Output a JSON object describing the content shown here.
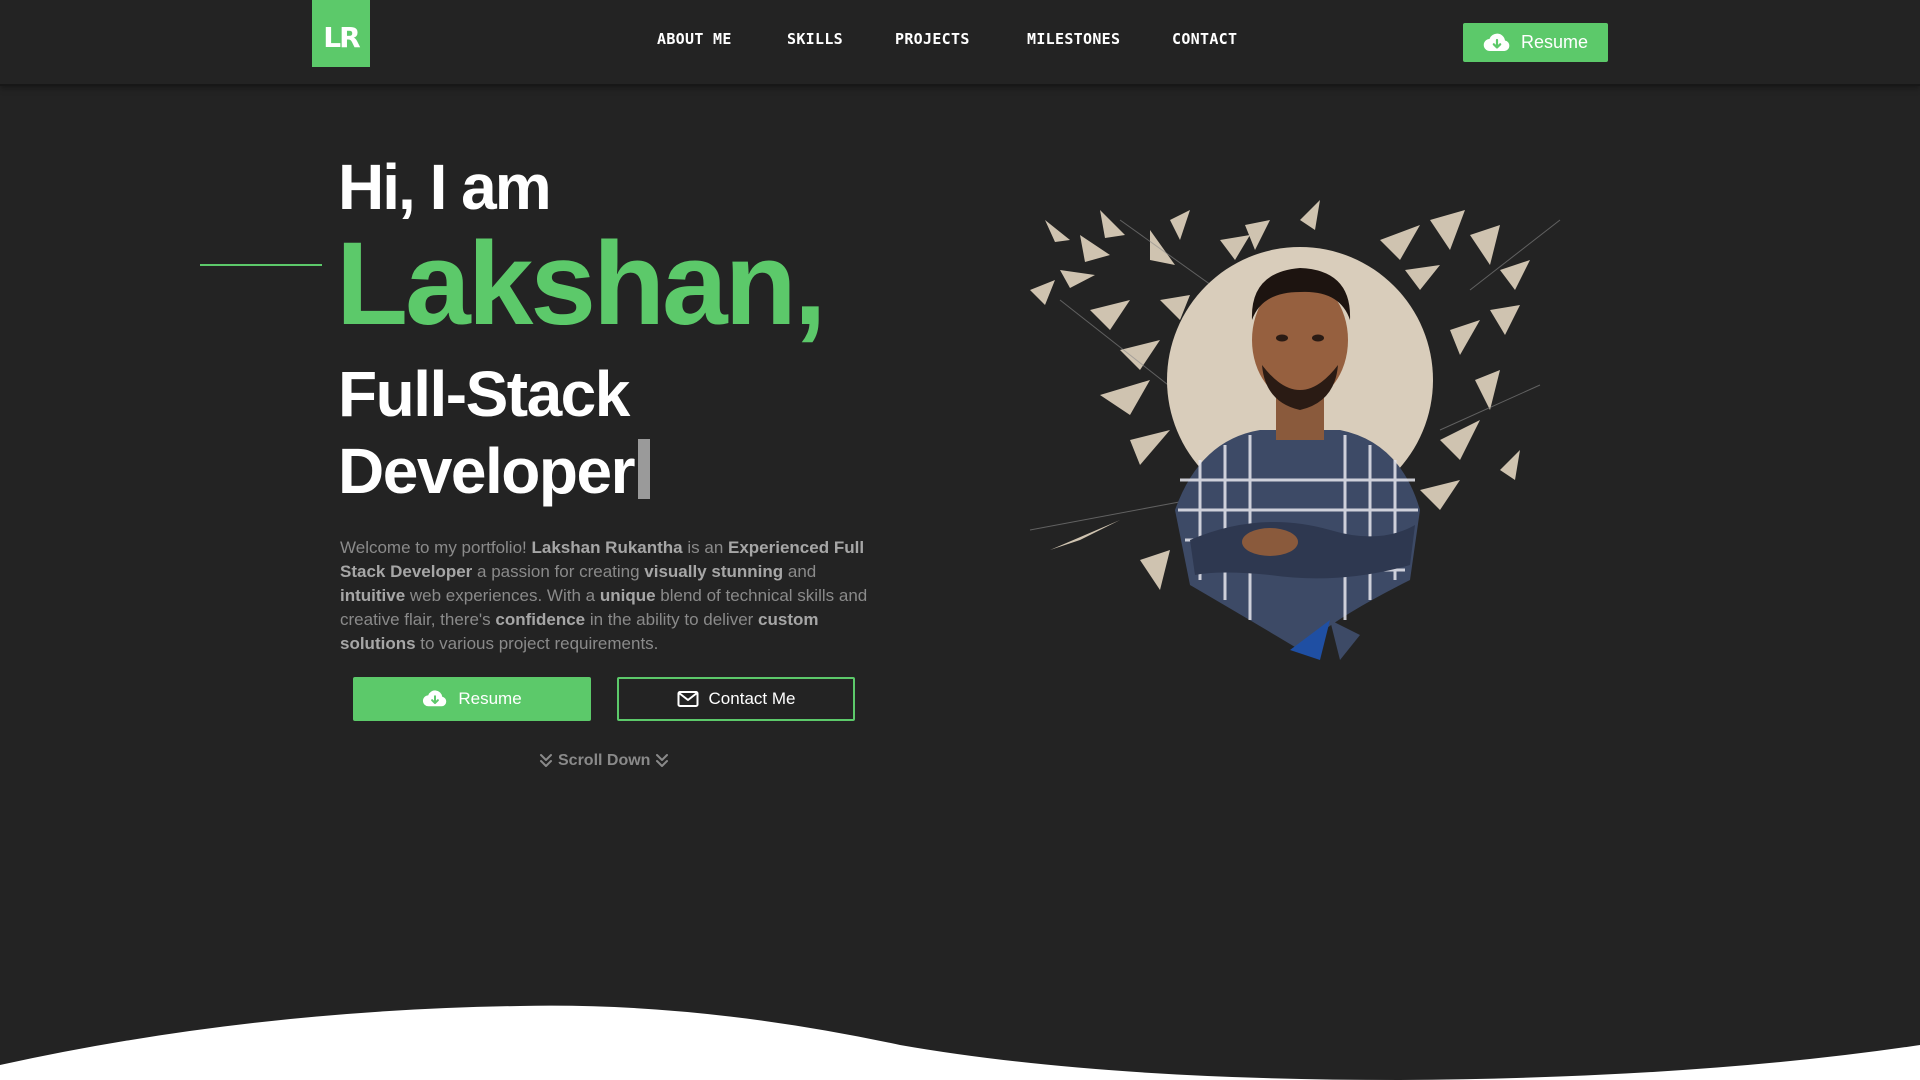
{
  "nav": {
    "logo": "LR",
    "links": [
      "ABOUT ME",
      "SKILLS",
      "PROJECTS",
      "MILESTONES",
      "CONTACT"
    ],
    "resume_label": "Resume"
  },
  "hero": {
    "greeting": "Hi, I am",
    "name": "Lakshan,",
    "role_line1": "Full-Stack",
    "role_line2": "Developer",
    "description": {
      "p1": "Welcome to my portfolio! ",
      "b1": "Lakshan Rukantha",
      "p2": " is an ",
      "b2": "Experienced Full Stack Developer",
      "p3": " a passion for creating ",
      "b3": "visually stunning",
      "p4": " and ",
      "b4": "intuitive",
      "p5": " web experiences. With a ",
      "b5": "unique",
      "p6": " blend of technical skills and creative flair, there's ",
      "b6": "confidence",
      "p7": " in the ability to deliver ",
      "b7": "custom solutions",
      "p8": " to various project requirements."
    },
    "resume_button": "Resume",
    "contact_button": "Contact Me",
    "scroll_label": "Scroll Down"
  },
  "colors": {
    "accent": "#5cc96a",
    "background": "#232323",
    "muted_text": "#8a8a8a"
  },
  "icons": {
    "download": "cloud-download-icon",
    "mail": "envelope-icon",
    "scroll": "double-chevron-down-icon"
  }
}
